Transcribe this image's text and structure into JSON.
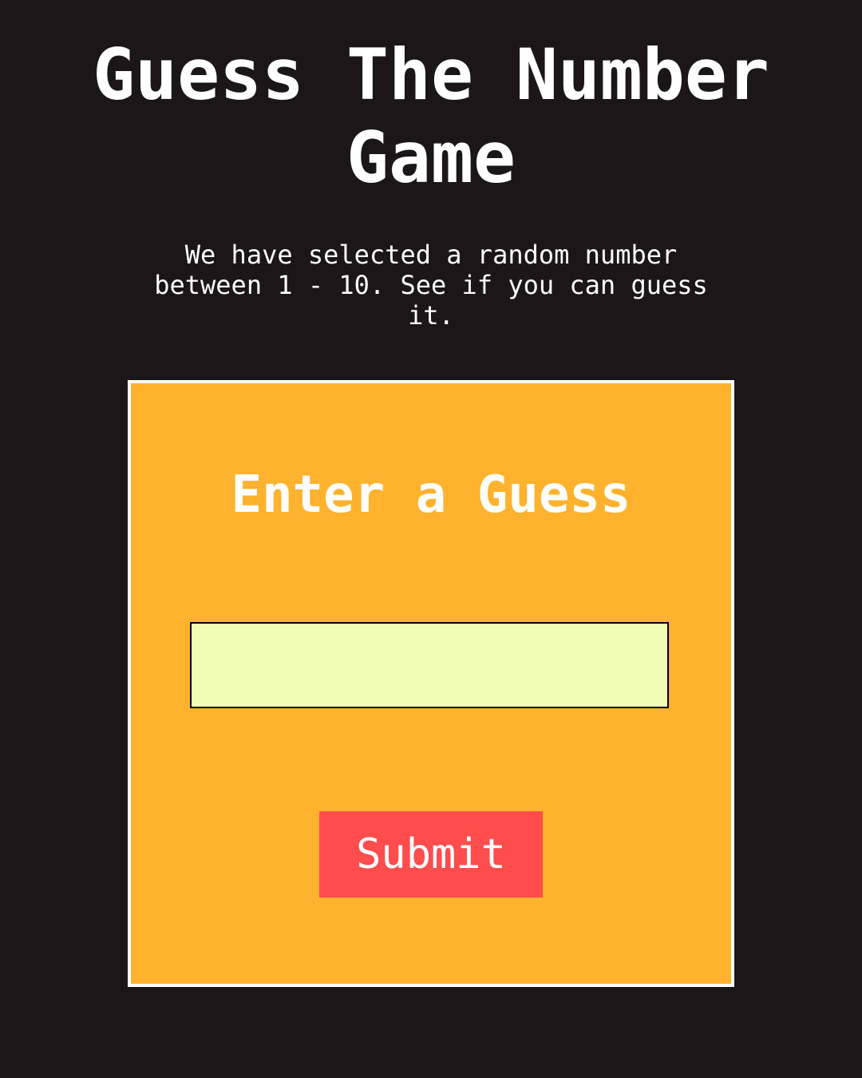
{
  "header": {
    "title": "Guess The Number Game",
    "description": "We have selected a random number between 1 - 10. See if you can guess it."
  },
  "game_card": {
    "heading": "Enter a Guess",
    "input": {
      "value": "",
      "placeholder": ""
    },
    "submit_label": "Submit"
  },
  "colors": {
    "background": "#1b1617",
    "card": "#ffb22e",
    "card_border": "#ffffff",
    "input_background": "#f1fdb5",
    "button": "#ff4d4d",
    "text": "#ffffff"
  }
}
